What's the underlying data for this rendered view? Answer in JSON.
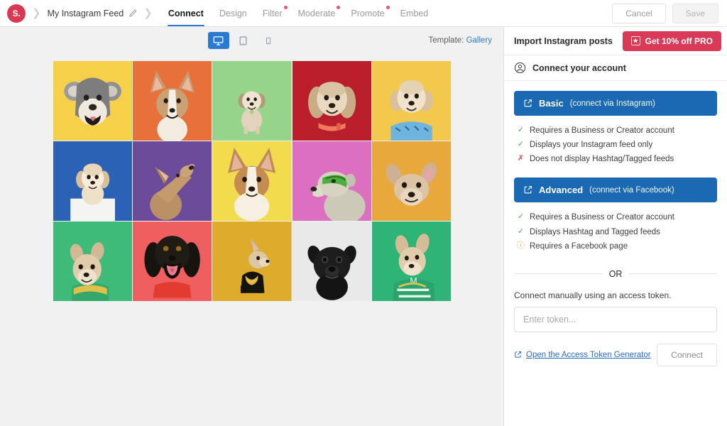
{
  "topbar": {
    "logo_text": "S.",
    "breadcrumb": "My Instagram Feed",
    "edit_icon": "pencil-icon",
    "tabs": [
      {
        "label": "Connect",
        "active": true,
        "dot": false
      },
      {
        "label": "Design",
        "active": false,
        "dot": false
      },
      {
        "label": "Filter",
        "active": false,
        "dot": true
      },
      {
        "label": "Moderate",
        "active": false,
        "dot": true
      },
      {
        "label": "Promote",
        "active": false,
        "dot": true
      },
      {
        "label": "Embed",
        "active": false,
        "dot": false
      }
    ],
    "cancel_label": "Cancel",
    "save_label": "Save"
  },
  "canvas": {
    "devices": [
      {
        "name": "desktop-view",
        "icon": "desktop-icon",
        "active": true
      },
      {
        "name": "tablet-view",
        "icon": "tablet-icon",
        "active": false
      },
      {
        "name": "mobile-view",
        "icon": "mobile-icon",
        "active": false
      }
    ],
    "template_label": "Template:",
    "template_value": "Gallery",
    "grid": {
      "columns": 5,
      "rows": 3,
      "cells": [
        {
          "bg": "#f6d049",
          "subject": "schnauzer-puppy"
        },
        {
          "bg": "#e8703a",
          "subject": "corgi-puppy"
        },
        {
          "bg": "#96d48c",
          "subject": "shih-tzu-standing"
        },
        {
          "bg": "#b81f2b",
          "subject": "shih-tzu-portrait"
        },
        {
          "bg": "#f2c94c",
          "subject": "poodle-in-shirt"
        },
        {
          "bg": "#2b62b5",
          "subject": "puppy-on-box"
        },
        {
          "bg": "#6b4b9a",
          "subject": "chihuahua-looking-up"
        },
        {
          "bg": "#f2dc4e",
          "subject": "corgi-face"
        },
        {
          "bg": "#dd6fc0",
          "subject": "dog-with-goggles"
        },
        {
          "bg": "#e8a93c",
          "subject": "french-bulldog-lying"
        },
        {
          "bg": "#3ebb79",
          "subject": "frenchie-with-chain"
        },
        {
          "bg": "#ef5f5f",
          "subject": "black-dog-barking"
        },
        {
          "bg": "#dfab2c",
          "subject": "chihuahua-gold-chain"
        },
        {
          "bg": "#e9e9e9",
          "subject": "pug-black-and-white"
        },
        {
          "bg": "#2fb477",
          "subject": "frenchie-green-jersey"
        }
      ]
    }
  },
  "panel": {
    "header_title": "Import Instagram posts",
    "pro_button": "Get 10% off PRO",
    "pro_icon": "star-badge-icon",
    "section_title": "Connect your account",
    "account_icon": "user-circle-icon",
    "methods": [
      {
        "name": "Basic",
        "subtitle": "(connect via Instagram)",
        "icon": "external-link-icon",
        "features": [
          {
            "mark": "check",
            "text": "Requires a Business or Creator account"
          },
          {
            "mark": "check",
            "text": "Displays your Instagram feed only"
          },
          {
            "mark": "cross",
            "text": "Does not display Hashtag/Tagged feeds"
          }
        ]
      },
      {
        "name": "Advanced",
        "subtitle": "(connect via Facebook)",
        "icon": "external-link-icon",
        "features": [
          {
            "mark": "check",
            "text": "Requires a Business or Creator account"
          },
          {
            "mark": "check",
            "text": "Displays Hashtag and Tagged feeds"
          },
          {
            "mark": "warn",
            "text": "Requires a Facebook page"
          }
        ]
      }
    ],
    "or_label": "OR",
    "manual_label": "Connect manually using an access token.",
    "token_placeholder": "Enter token...",
    "token_value": "",
    "generator_link": "Open the Access Token Generator",
    "generator_icon": "external-link-icon",
    "connect_label": "Connect"
  },
  "colors": {
    "brand_red": "#d93852",
    "accent_blue": "#2a7ad2",
    "button_blue": "#1b68b3",
    "pro_red": "#d93a57",
    "ok_green": "#4caf50",
    "error_red": "#e04545",
    "warn_amber": "#e8a33d",
    "canvas_bg": "#f1f1f1"
  }
}
